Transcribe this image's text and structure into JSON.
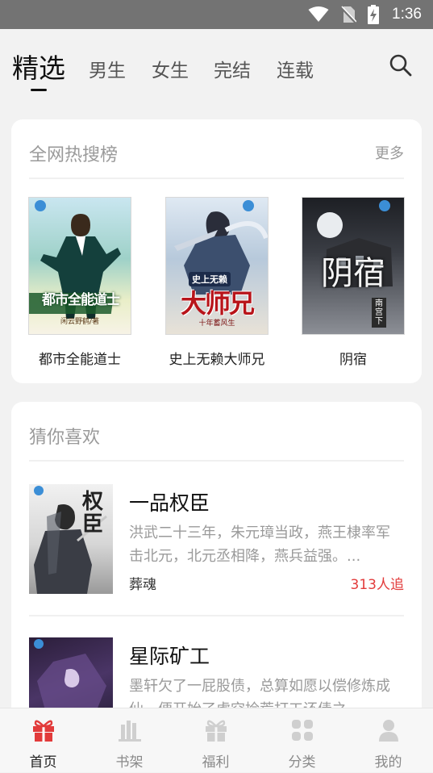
{
  "status": {
    "time": "1:36"
  },
  "tabs": [
    {
      "label": "精选",
      "active": true
    },
    {
      "label": "男生"
    },
    {
      "label": "女生"
    },
    {
      "label": "完结"
    },
    {
      "label": "连载"
    }
  ],
  "hot": {
    "title": "全网热搜榜",
    "more": "更多",
    "books": [
      {
        "name": "都市全能道士",
        "cover_text": "都市全能道士",
        "cover_author": "闲云野鹤/著",
        "cover_publisher": "爱阅"
      },
      {
        "name": "史上无赖大师兄",
        "cover_text": "大师兄",
        "cover_subtext": "史上无赖",
        "cover_author": "十年蓄风生",
        "cover_publisher": "爱阅"
      },
      {
        "name": "阴宿",
        "cover_text": "阴宿",
        "cover_author": "南宫下",
        "cover_publisher": "爱阅"
      }
    ]
  },
  "recommend": {
    "title": "猜你喜欢",
    "items": [
      {
        "title": "一品权臣",
        "desc": "洪武二十三年，朱元璋当政，燕王棣率军击北元，北元丞相降，燕兵益强。...",
        "author": "葬魂",
        "follow": "313人追",
        "cover_text": "权臣",
        "cover_publisher": "爱阅"
      },
      {
        "title": "星际矿工",
        "desc": "墨轩欠了一屁股债，总算如愿以偿修炼成仙，便开始了虚空捡荒打工还债之",
        "cover_publisher": "爱阅"
      }
    ]
  },
  "bottom_nav": [
    {
      "label": "首页",
      "icon": "gift-icon",
      "active": true
    },
    {
      "label": "书架",
      "icon": "bookshelf-icon"
    },
    {
      "label": "福利",
      "icon": "gift-icon"
    },
    {
      "label": "分类",
      "icon": "grid-icon"
    },
    {
      "label": "我的",
      "icon": "user-icon"
    }
  ],
  "colors": {
    "accent": "#e23b3b",
    "bg": "#f2f2f2",
    "muted": "#9a9a9a"
  }
}
